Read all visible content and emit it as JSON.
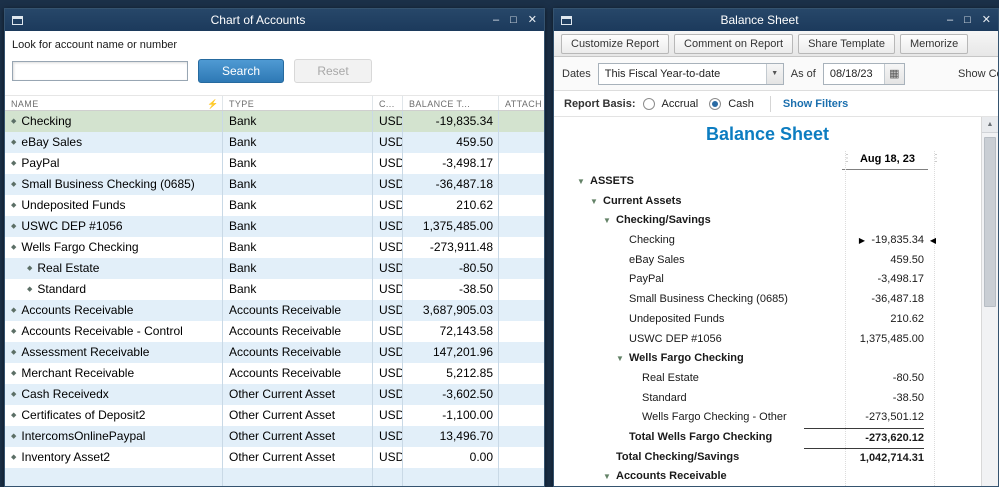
{
  "icons": {
    "minimize": "–",
    "maximize": "□",
    "close": "✕",
    "flash": "⚡",
    "collapse": "▼",
    "diamond": "◆",
    "dropdown_caret": "▼",
    "calendar": "▦",
    "scroll_up": "▲",
    "right_arrow": "▶",
    "left_arrow": "◀",
    "column_grip": "⋮"
  },
  "colors": {
    "titlebar": "#274769",
    "titlebar_dark": "#1c3a5c",
    "accent_blue": "#4f9ad3",
    "selected_row_green": "#d3e3cf",
    "stripe_blue": "#e2eff9",
    "report_title_blue": "#0d7dc1",
    "link_blue": "#1b6fae"
  },
  "left_window": {
    "title": "Chart of Accounts",
    "search": {
      "label": "Look for account name or number",
      "value": "",
      "search_button": "Search",
      "reset_button": "Reset"
    },
    "columns": {
      "name": "NAME",
      "type": "TYPE",
      "currency": "C...",
      "balance": "BALANCE T...",
      "attach": "ATTACH"
    },
    "rows": [
      {
        "name": "Checking",
        "type": "Bank",
        "currency": "USD",
        "balance": "-19,835.34",
        "selected": true
      },
      {
        "name": "eBay Sales",
        "type": "Bank",
        "currency": "USD",
        "balance": "459.50"
      },
      {
        "name": "PayPal",
        "type": "Bank",
        "currency": "USD",
        "balance": "-3,498.17"
      },
      {
        "name": "Small Business Checking (0685)",
        "type": "Bank",
        "currency": "USD",
        "balance": "-36,487.18"
      },
      {
        "name": "Undeposited Funds",
        "type": "Bank",
        "currency": "USD",
        "balance": "210.62"
      },
      {
        "name": "USWC DEP #1056",
        "type": "Bank",
        "currency": "USD",
        "balance": "1,375,485.00"
      },
      {
        "name": "Wells Fargo Checking",
        "type": "Bank",
        "currency": "USD",
        "balance": "-273,911.48"
      },
      {
        "name": "Real Estate",
        "type": "Bank",
        "currency": "USD",
        "balance": "-80.50",
        "sub": true
      },
      {
        "name": "Standard",
        "type": "Bank",
        "currency": "USD",
        "balance": "-38.50",
        "sub": true
      },
      {
        "name": "Accounts Receivable",
        "type": "Accounts Receivable",
        "currency": "USD",
        "balance": "3,687,905.03"
      },
      {
        "name": "Accounts Receivable - Control",
        "type": "Accounts Receivable",
        "currency": "USD",
        "balance": "72,143.58"
      },
      {
        "name": "Assessment Receivable",
        "type": "Accounts Receivable",
        "currency": "USD",
        "balance": "147,201.96"
      },
      {
        "name": "Merchant Receivable",
        "type": "Accounts Receivable",
        "currency": "USD",
        "balance": "5,212.85"
      },
      {
        "name": "Cash Receivedx",
        "type": "Other Current Asset",
        "currency": "USD",
        "balance": "-3,602.50"
      },
      {
        "name": "Certificates of Deposit2",
        "type": "Other Current Asset",
        "currency": "USD",
        "balance": "-1,100.00"
      },
      {
        "name": "IntercomsOnlinePaypal",
        "type": "Other Current Asset",
        "currency": "USD",
        "balance": "13,496.70"
      },
      {
        "name": "Inventory Asset2",
        "type": "Other Current Asset",
        "currency": "USD",
        "balance": "0.00"
      },
      {
        "name": "",
        "type": "",
        "currency": "",
        "balance": "",
        "empty": true
      }
    ]
  },
  "right_window": {
    "title": "Balance Sheet",
    "toolbar": [
      "Customize Report",
      "Comment on Report",
      "Share Template",
      "Memorize"
    ],
    "filters": {
      "dates_label": "Dates",
      "dates_value": "This Fiscal Year-to-date",
      "as_of_label": "As of",
      "as_of_value": "08/18/23",
      "show_columns_label": "Show Colu"
    },
    "basis": {
      "label": "Report Basis:",
      "accrual": "Accrual",
      "cash": "Cash",
      "selected": "Cash",
      "show_filters": "Show Filters"
    },
    "report": {
      "title": "Balance Sheet",
      "column_header": "Aug 18, 23",
      "rows": [
        {
          "label": "ASSETS",
          "value": "",
          "indent": 0,
          "bold": true,
          "triangle": true
        },
        {
          "label": "Current Assets",
          "value": "",
          "indent": 1,
          "bold": true,
          "triangle": true
        },
        {
          "label": "Checking/Savings",
          "value": "",
          "indent": 2,
          "bold": true,
          "triangle": true
        },
        {
          "label": "Checking",
          "value": "-19,835.34",
          "indent": 3,
          "selected": true
        },
        {
          "label": "eBay Sales",
          "value": "459.50",
          "indent": 3
        },
        {
          "label": "PayPal",
          "value": "-3,498.17",
          "indent": 3
        },
        {
          "label": "Small Business Checking (0685)",
          "value": "-36,487.18",
          "indent": 3
        },
        {
          "label": "Undeposited Funds",
          "value": "210.62",
          "indent": 3
        },
        {
          "label": "USWC DEP #1056",
          "value": "1,375,485.00",
          "indent": 3
        },
        {
          "label": "Wells Fargo Checking",
          "value": "",
          "indent": 3,
          "bold": true,
          "triangle": true
        },
        {
          "label": "Real Estate",
          "value": "-80.50",
          "indent": 4
        },
        {
          "label": "Standard",
          "value": "-38.50",
          "indent": 4
        },
        {
          "label": "Wells Fargo Checking - Other",
          "value": "-273,501.12",
          "indent": 4
        },
        {
          "label": "Total Wells Fargo Checking",
          "value": "-273,620.12",
          "indent": 3,
          "bold": true,
          "topline": true
        },
        {
          "label": "Total Checking/Savings",
          "value": "1,042,714.31",
          "indent": 2,
          "bold": true,
          "topline": true
        },
        {
          "label": "Accounts Receivable",
          "value": "",
          "indent": 2,
          "bold": true,
          "triangle": true
        }
      ]
    }
  }
}
